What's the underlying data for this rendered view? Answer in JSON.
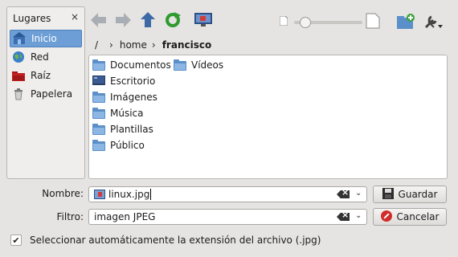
{
  "sidebar": {
    "title": "Lugares",
    "close_glyph": "×",
    "items": [
      {
        "label": "Inicio",
        "icon": "home-icon",
        "selected": true
      },
      {
        "label": "Red",
        "icon": "network-globe-icon",
        "selected": false
      },
      {
        "label": "Raíz",
        "icon": "root-folder-icon",
        "selected": false
      },
      {
        "label": "Papelera",
        "icon": "trash-icon",
        "selected": false
      }
    ]
  },
  "toolbar": {
    "back": "back-arrow-icon",
    "forward": "forward-arrow-icon",
    "up": "up-arrow-icon",
    "reload": "reload-icon",
    "preview": "preview-icon",
    "zoom_level": 0.1,
    "new_folder": "new-folder-icon",
    "options": "options-wrench-icon"
  },
  "breadcrumb": {
    "root": "/",
    "items": [
      "home",
      "francisco"
    ]
  },
  "files": {
    "column1": [
      "Documentos",
      "Escritorio",
      "Imágenes",
      "Música",
      "Plantillas",
      "Público"
    ],
    "column2": [
      "Vídeos"
    ]
  },
  "form": {
    "name_label": "Nombre:",
    "name_value": "linux.jpg",
    "filter_label": "Filtro:",
    "filter_value": "imagen JPEG",
    "save_label": "Guardar",
    "cancel_label": "Cancelar",
    "auto_ext_label": "Seleccionar automáticamente la extensión del archivo (.jpg)",
    "auto_ext_checked": true
  },
  "colors": {
    "selection": "#6d9fd6",
    "folder": "#5b8fc9",
    "background": "#e5e4e2"
  }
}
